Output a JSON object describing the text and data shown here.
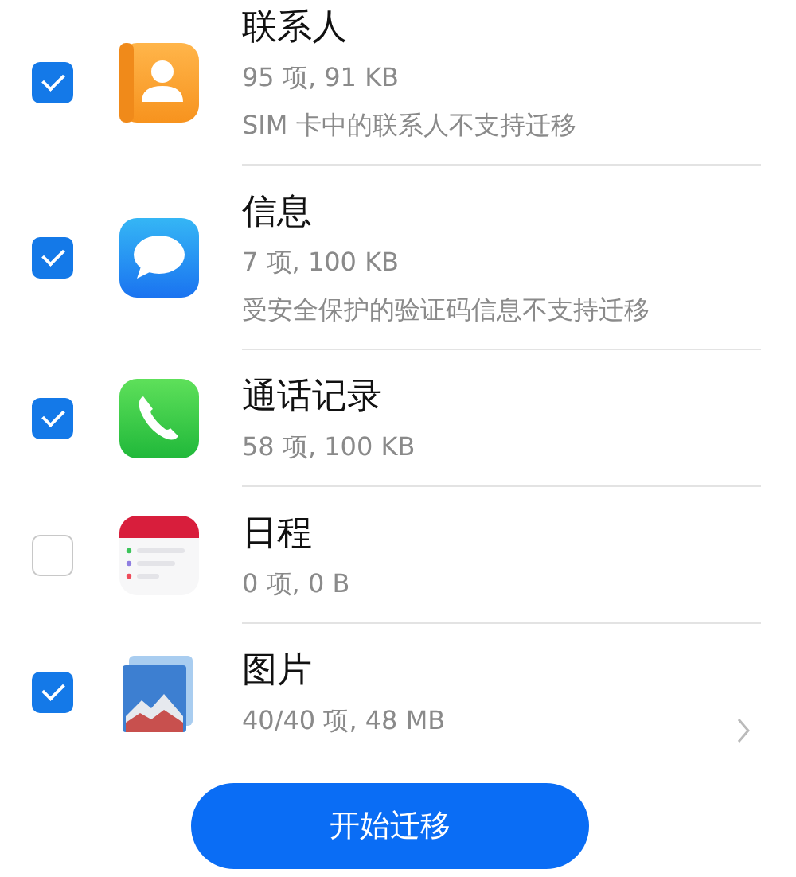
{
  "items": [
    {
      "title": "联系人",
      "details": [
        "95 项, 91 KB",
        "SIM 卡中的联系人不支持迁移"
      ],
      "checked": true,
      "kind": "contacts",
      "has_chevron": false
    },
    {
      "title": "信息",
      "details": [
        "7 项, 100 KB",
        "受安全保护的验证码信息不支持迁移"
      ],
      "checked": true,
      "kind": "messages",
      "has_chevron": false
    },
    {
      "title": "通话记录",
      "details": [
        "58 项, 100 KB"
      ],
      "checked": true,
      "kind": "calls",
      "has_chevron": false
    },
    {
      "title": "日程",
      "details": [
        "0 项, 0 B"
      ],
      "checked": false,
      "kind": "calendar",
      "has_chevron": false
    },
    {
      "title": "图片",
      "details": [
        "40/40 项, 48 MB"
      ],
      "checked": true,
      "kind": "gallery",
      "has_chevron": true
    }
  ],
  "start_button": "开始迁移"
}
